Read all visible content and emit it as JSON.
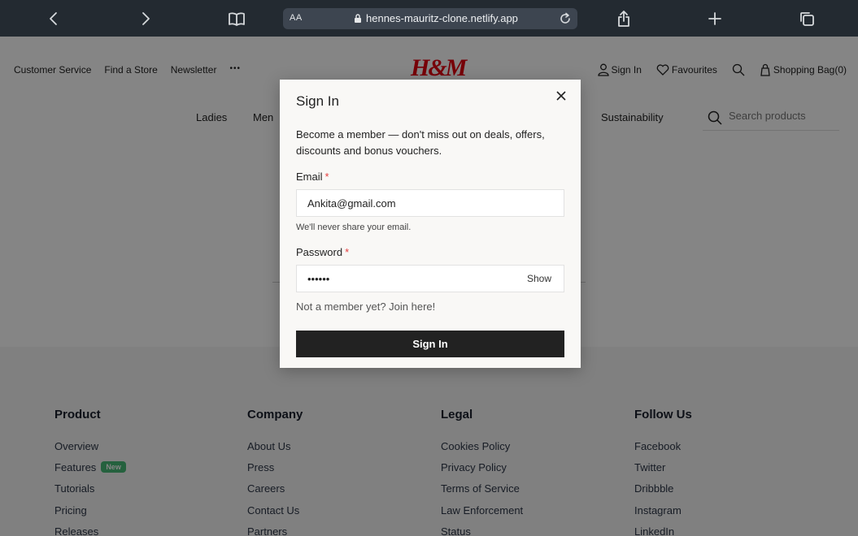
{
  "browser": {
    "text_size_label": "AA",
    "url": "hennes-mauritz-clone.netlify.app"
  },
  "header": {
    "left_links": [
      "Customer Service",
      "Find a Store",
      "Newsletter"
    ],
    "more_label": "•••",
    "logo": "H&M",
    "sign_in": "Sign In",
    "favourites": "Favourites",
    "shopping_bag": "Shopping Bag(0)"
  },
  "categories": {
    "ladies": "Ladies",
    "men": "Men",
    "sustainability": "Sustainability"
  },
  "search": {
    "placeholder": "Search products"
  },
  "footer": {
    "product": {
      "title": "Product",
      "links": [
        "Overview",
        "Features",
        "Tutorials",
        "Pricing",
        "Releases"
      ],
      "new_badge": "New"
    },
    "company": {
      "title": "Company",
      "links": [
        "About Us",
        "Press",
        "Careers",
        "Contact Us",
        "Partners"
      ]
    },
    "legal": {
      "title": "Legal",
      "links": [
        "Cookies Policy",
        "Privacy Policy",
        "Terms of Service",
        "Law Enforcement",
        "Status"
      ]
    },
    "follow": {
      "title": "Follow Us",
      "links": [
        "Facebook",
        "Twitter",
        "Dribbble",
        "Instagram",
        "LinkedIn"
      ]
    }
  },
  "modal": {
    "title": "Sign In",
    "description": "Become a member — don't miss out on deals, offers, discounts and bonus vouchers.",
    "email_label": "Email",
    "required_mark": "*",
    "email_value": "Ankita@gmail.com",
    "email_helper": "We'll never share your email.",
    "password_label": "Password",
    "password_value": "••••••",
    "show_label": "Show",
    "join_text": "Not a member yet? Join here!",
    "submit_label": "Sign In"
  }
}
